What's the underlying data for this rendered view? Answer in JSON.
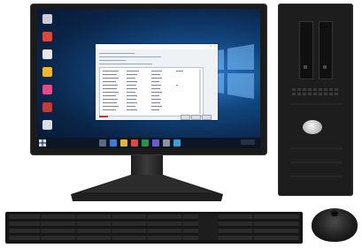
{
  "image": {
    "subject": "desktop-computer",
    "components": [
      "monitor",
      "tower",
      "keyboard",
      "mouse"
    ]
  },
  "colors": {
    "screen_blue": "#12467f",
    "window_bg": "#eef2f6",
    "hardware_black": "#1b1b1b",
    "power_button": "#d9d9d9",
    "accent_red": "#c0392b"
  }
}
